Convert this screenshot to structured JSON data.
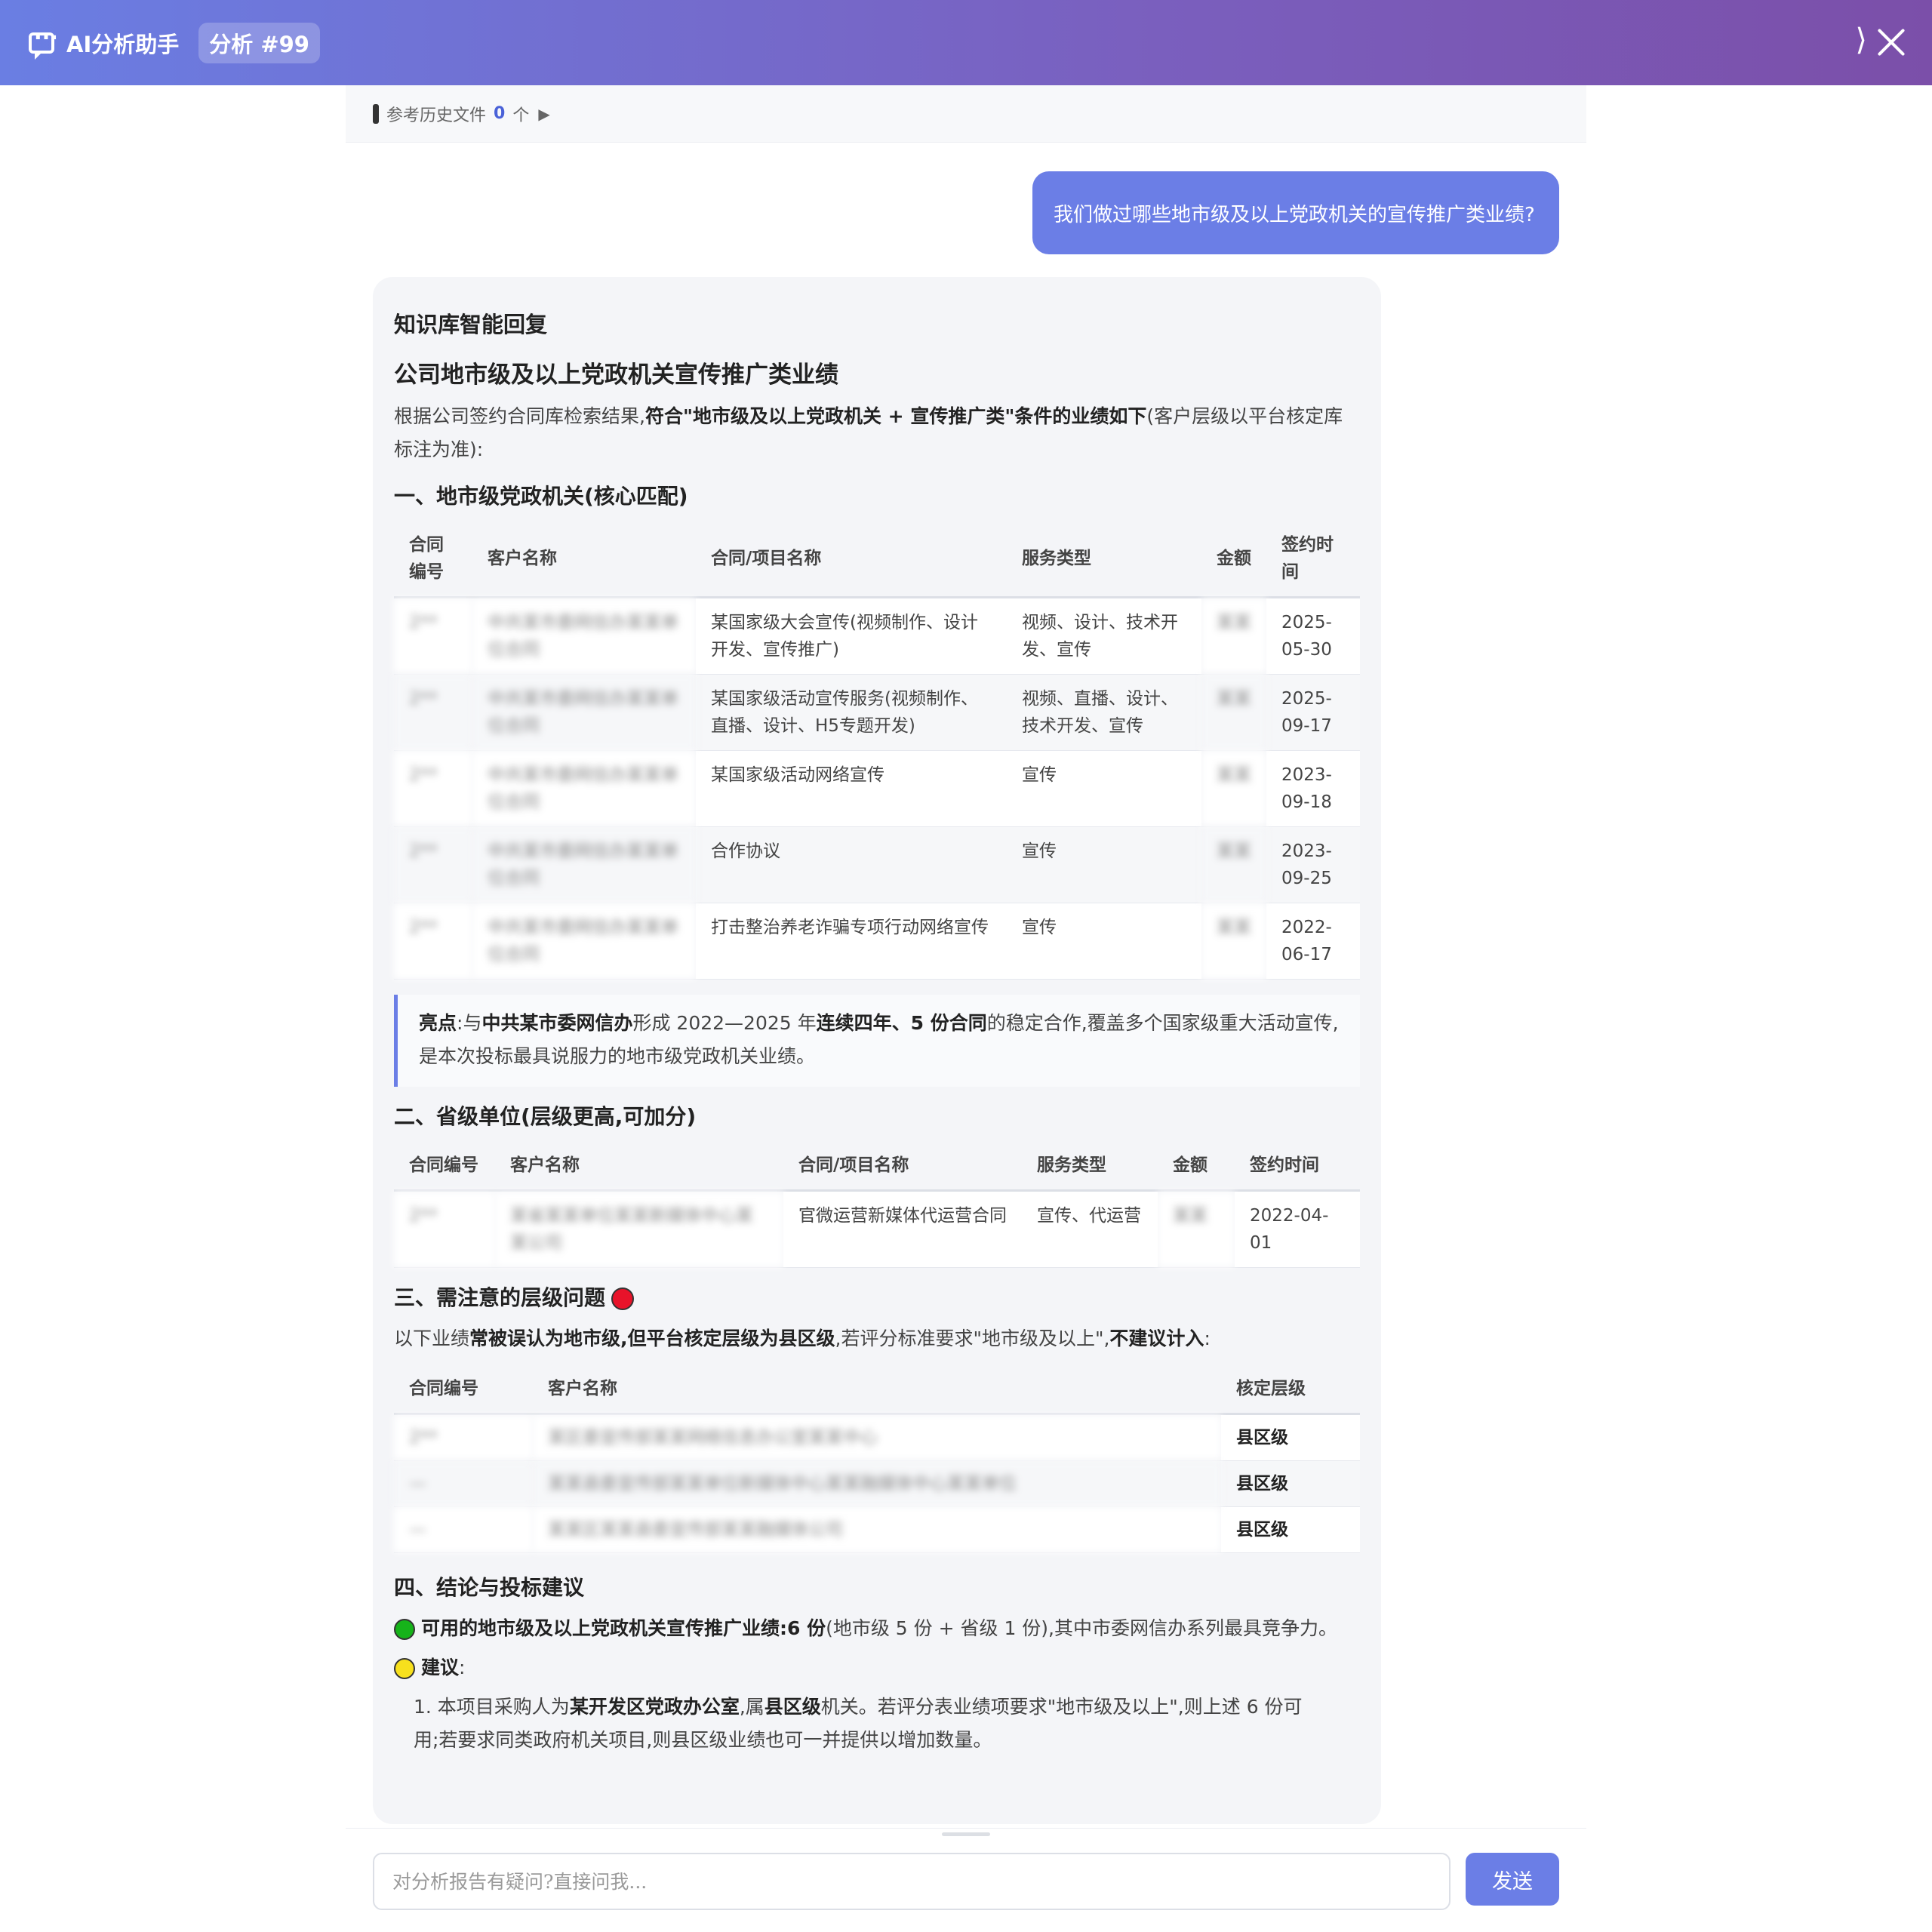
{
  "header": {
    "app_title": "AI分析助手",
    "analysis_badge": "分析 #99",
    "collapse_glyph": "⟩",
    "icons": {
      "chat": "chat-bubble-icon",
      "collapse": "collapse-icon",
      "close": "close-icon"
    }
  },
  "reference_bar": {
    "label": "参考历史文件",
    "count": "0",
    "unit": "个",
    "caret": "▶"
  },
  "user_message": "我们做过哪些地市级及以上党政机关的宣传推广类业绩?",
  "answer": {
    "heading": "知识库智能回复",
    "title": "公司地市级及以上党政机关宣传推广类业绩",
    "intro_prefix": "根据公司签约合同库检索结果,",
    "intro_bold": "符合\"地市级及以上党政机关 + 宣传推广类\"条件的业绩如下",
    "intro_suffix": "(客户层级以平台核定库标注为准):",
    "section1": {
      "title": "一、地市级党政机关(核心匹配)",
      "headers": [
        "合同编号",
        "客户名称",
        "合同/项目名称",
        "服务类型",
        "金额",
        "签约时间"
      ],
      "rows": [
        {
          "id": "2**",
          "client": "中共某市委网信办某某单位合同",
          "project": "某国家级大会宣传(视频制作、设计开发、宣传推广)",
          "service": "视频、设计、技术开发、宣传",
          "amount": "某某",
          "date": "2025-05-30"
        },
        {
          "id": "2**",
          "client": "中共某市委网信办某某单位合同",
          "project": "某国家级活动宣传服务(视频制作、直播、设计、H5专题开发)",
          "service": "视频、直播、设计、技术开发、宣传",
          "amount": "某某",
          "date": "2025-09-17"
        },
        {
          "id": "2**",
          "client": "中共某市委网信办某某单位合同",
          "project": "某国家级活动网络宣传",
          "service": "宣传",
          "amount": "某某",
          "date": "2023-09-18"
        },
        {
          "id": "2**",
          "client": "中共某市委网信办某某单位合同",
          "project": "合作协议",
          "service": "宣传",
          "amount": "某某",
          "date": "2023-09-25"
        },
        {
          "id": "2**",
          "client": "中共某市委网信办某某单位合同",
          "project": "打击整治养老诈骗专项行动网络宣传",
          "service": "宣传",
          "amount": "某某",
          "date": "2022-06-17"
        }
      ]
    },
    "highlight": {
      "label": "亮点",
      "t1": ":与",
      "b1": "中共某市委网信办",
      "t2": "形成 2022—2025 年",
      "b2": "连续四年、5 份合同",
      "t3": "的稳定合作,覆盖多个国家级重大活动宣传,是本次投标最具说服力的地市级党政机关业绩。"
    },
    "section2": {
      "title": "二、省级单位(层级更高,可加分)",
      "headers": [
        "合同编号",
        "客户名称",
        "合同/项目名称",
        "服务类型",
        "金额",
        "签约时间"
      ],
      "rows": [
        {
          "id": "2**",
          "client": "某省某某单位某某新媒体中心某某公司",
          "project": "官微运营新媒体代运营合同",
          "service": "宣传、代运营",
          "amount": "某某",
          "date": "2022-04-01"
        }
      ]
    },
    "section3": {
      "title": "三、需注意的层级问题",
      "icon": "red-circle-icon",
      "p_prefix": "以下业绩",
      "p_bold1": "常被误认为地市级,但平台核定层级为县区级",
      "p_mid": ",若评分标准要求\"地市级及以上\",",
      "p_bold2": "不建议计入",
      "p_suffix": ":",
      "headers": [
        "合同编号",
        "客户名称",
        "核定层级"
      ],
      "rows": [
        {
          "id": "2**",
          "client": "某区委宣传部某某网络信息办公室某某中心",
          "level": "县区级"
        },
        {
          "id": "—",
          "client": "某某县委宣传部某某单位新媒体中心某某融媒体中心某某单位",
          "level": "县区级"
        },
        {
          "id": "—",
          "client": "某某区某某县委宣传部某某融媒体公司",
          "level": "县区级"
        }
      ]
    },
    "section4": {
      "title": "四、结论与投标建议",
      "conclusion_bold": "可用的地市级及以上党政机关宣传推广业绩:6 份",
      "conclusion_rest": "(地市级 5 份 + 省级 1 份),其中市委网信办系列最具竞争力。",
      "suggest_label": "建议",
      "suggest_colon": ":",
      "item1_prefix": "1. 本项目采购人为",
      "item1_bold1": "某开发区党政办公室",
      "item1_mid": ",属",
      "item1_bold2": "县区级",
      "item1_suffix": "机关。若评分表业绩项要求\"地市级及以上\",则上述 6 份可",
      "item1_cont": "用;若要求同类政府机关项目,则县区级业绩也可一并提供以增加数量。"
    }
  },
  "input": {
    "placeholder": "对分析报告有疑问?直接问我...",
    "send_label": "发送"
  }
}
